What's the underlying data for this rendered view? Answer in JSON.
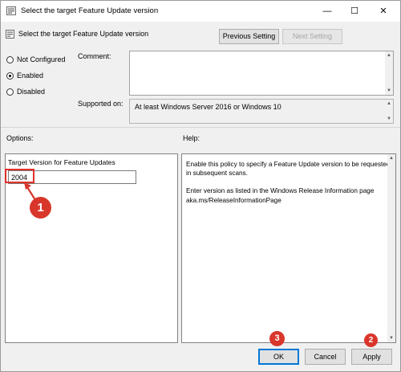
{
  "window": {
    "title": "Select the target Feature Update version",
    "minimize_glyph": "—",
    "maximize_glyph": "☐",
    "close_glyph": "✕"
  },
  "header": {
    "policy_name": "Select the target Feature Update version",
    "previous_setting_label": "Previous Setting",
    "next_setting_label": "Next Setting"
  },
  "state": {
    "options": [
      {
        "label": "Not Configured",
        "checked": false
      },
      {
        "label": "Enabled",
        "checked": true
      },
      {
        "label": "Disabled",
        "checked": false
      }
    ]
  },
  "comment": {
    "label": "Comment:",
    "value": ""
  },
  "supported": {
    "label": "Supported on:",
    "value": "At least Windows Server 2016 or Windows 10"
  },
  "options_panel": {
    "heading": "Options:",
    "field_label": "Target Version for Feature Updates",
    "field_value": "2004"
  },
  "help_panel": {
    "heading": "Help:",
    "paragraph1": "Enable this policy to specify a Feature Update version to be requested in subsequent scans.",
    "paragraph2": "Enter version as listed in the Windows Release Information page aka.ms/ReleaseInformationPage"
  },
  "footer": {
    "ok_label": "OK",
    "cancel_label": "Cancel",
    "apply_label": "Apply"
  },
  "annotations": {
    "marker_1": "1",
    "marker_2": "2",
    "marker_3": "3",
    "color": "#d9362b"
  }
}
